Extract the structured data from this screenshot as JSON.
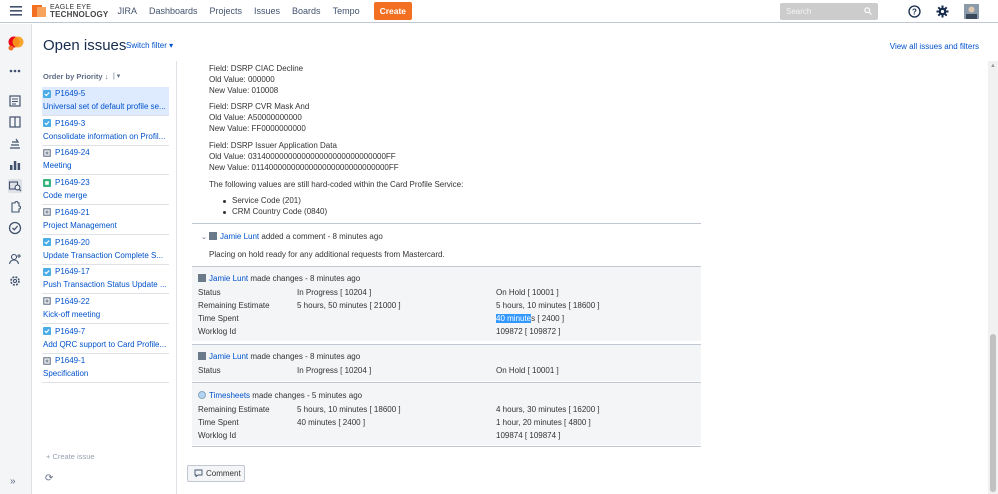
{
  "topbar": {
    "logo_line1": "EAGLE EYE",
    "logo_line2": "TECHNOLOGY",
    "nav": [
      "JIRA",
      "Dashboards",
      "Projects",
      "Issues",
      "Boards",
      "Tempo"
    ],
    "create_label": "Create",
    "search_placeholder": "Search"
  },
  "header": {
    "title": "Open issues",
    "switch_filter": "Switch filter",
    "view_all": "View all issues and filters"
  },
  "list": {
    "order_by": "Order by Priority",
    "issues": [
      {
        "key": "P1649-5",
        "summary": "Universal set of default profile se...",
        "type": "task"
      },
      {
        "key": "P1649-3",
        "summary": "Consolidate information on Profil...",
        "type": "task"
      },
      {
        "key": "P1649-24",
        "summary": "Meeting",
        "type": "sub"
      },
      {
        "key": "P1649-23",
        "summary": "Code merge",
        "type": "story"
      },
      {
        "key": "P1649-21",
        "summary": "Project Management",
        "type": "sub"
      },
      {
        "key": "P1649-20",
        "summary": "Update Transaction Complete S...",
        "type": "task"
      },
      {
        "key": "P1649-17",
        "summary": "Push Transaction Status Update ...",
        "type": "task"
      },
      {
        "key": "P1649-22",
        "summary": "Kick-off meeting",
        "type": "sub"
      },
      {
        "key": "P1649-7",
        "summary": "Add QRC support to Card Profile...",
        "type": "task"
      },
      {
        "key": "P1649-1",
        "summary": "Specification",
        "type": "sub"
      }
    ],
    "create_issue": "+ Create issue"
  },
  "detail": {
    "fields": [
      {
        "field": "Field: DSRP CIAC Decline",
        "old": "Old Value: 000000",
        "new": "New Value: 010008"
      },
      {
        "field": "Field: DSRP CVR Mask And",
        "old": "Old Value: A50000000000",
        "new": "New Value: FF0000000000"
      },
      {
        "field": "Field: DSRP Issuer Application Data",
        "old": "Old Value: 0314000000000000000000000000000FF",
        "new": "New Value: 0114000000000000000000000000000FF"
      }
    ],
    "hardcoded_intro": "The following values are still hard-coded within the Card Profile Service:",
    "bullets": [
      "Service Code (201)",
      "CRM Country Code (0840)"
    ],
    "comment": {
      "author": "Jamie Lunt",
      "action": " added a comment - 8 minutes ago",
      "body": "Placing on hold ready for any additional requests from Mastercard."
    },
    "changes1": {
      "author": "Jamie Lunt",
      "action": " made changes - 8 minutes ago",
      "rows": [
        {
          "field": "Status",
          "old": "In Progress [ 10204 ]",
          "new": "On Hold [ 10001 ]"
        },
        {
          "field": "Remaining Estimate",
          "old": "5 hours, 50 minutes [ 21000 ]",
          "new": "5 hours, 10 minutes [ 18600 ]"
        },
        {
          "field": "Time Spent",
          "old": "",
          "new_hl": "40 minute",
          "new_rest": "s [ 2400 ]"
        },
        {
          "field": "Worklog Id",
          "old": "",
          "new": "109872 [ 109872 ]"
        }
      ]
    },
    "changes2": {
      "author": "Jamie Lunt",
      "action": " made changes - 8 minutes ago",
      "rows": [
        {
          "field": "Status",
          "old": "In Progress [ 10204 ]",
          "new": "On Hold [ 10001 ]"
        }
      ]
    },
    "changes3": {
      "author": "Timesheets",
      "action": " made changes - 5 minutes ago",
      "rows": [
        {
          "field": "Remaining Estimate",
          "old": "5 hours, 10 minutes [ 18600 ]",
          "new": "4 hours, 30 minutes [ 16200 ]"
        },
        {
          "field": "Time Spent",
          "old": "40 minutes [ 2400 ]",
          "new": "1 hour, 20 minutes [ 4800 ]"
        },
        {
          "field": "Worklog Id",
          "old": "",
          "new": "109874 [ 109874 ]"
        }
      ]
    },
    "comment_button": "Comment"
  },
  "colors": {
    "accent": "#0052cc",
    "create": "#f36f21",
    "selected": "#deebff"
  }
}
